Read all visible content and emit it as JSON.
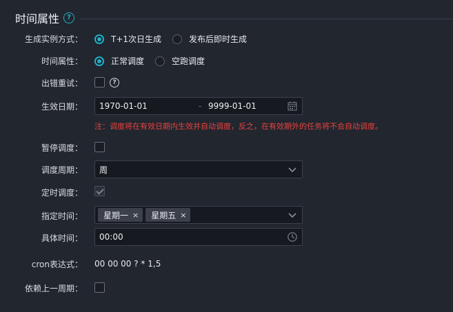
{
  "section": {
    "title": "时间属性",
    "help_icon": "?"
  },
  "fields": {
    "instance_mode": {
      "label": "生成实例方式：",
      "options": [
        {
          "label": "T+1次日生成",
          "checked": true
        },
        {
          "label": "发布后即时生成",
          "checked": false
        }
      ]
    },
    "time_property": {
      "label": "时间属性：",
      "options": [
        {
          "label": "正常调度",
          "checked": true
        },
        {
          "label": "空跑调度",
          "checked": false
        }
      ]
    },
    "retry_on_error": {
      "label": "出错重试：",
      "checked": false,
      "help_icon": "?"
    },
    "effective_date": {
      "label": "生效日期：",
      "start": "1970-01-01",
      "separator": "-",
      "end": "9999-01-01",
      "note": "注：调度将在有效日期内生效并自动调度，反之，在有效期外的任务将不会自动调度。"
    },
    "pause_schedule": {
      "label": "暂停调度：",
      "checked": false
    },
    "schedule_cycle": {
      "label": "调度周期：",
      "value": "周"
    },
    "timed_schedule": {
      "label": "定时调度：",
      "checked": true,
      "disabled": true
    },
    "specified_time": {
      "label": "指定时间：",
      "tags": [
        {
          "label": "星期一",
          "remove": "×"
        },
        {
          "label": "星期五",
          "remove": "×"
        }
      ]
    },
    "specific_time": {
      "label": "具体时间：",
      "value": "00:00"
    },
    "cron": {
      "label": "cron表达式：",
      "value": "00 00 00 ? * 1,5"
    },
    "depend_last_cycle": {
      "label": "依赖上一周期：",
      "checked": false
    }
  },
  "colors": {
    "accent": "#1fb1c9",
    "background": "#22262f",
    "input_background": "#161920",
    "note": "#e8423d"
  },
  "icons": [
    "help-circle-icon",
    "calendar-icon",
    "chevron-down-icon",
    "clock-icon",
    "close-icon"
  ]
}
